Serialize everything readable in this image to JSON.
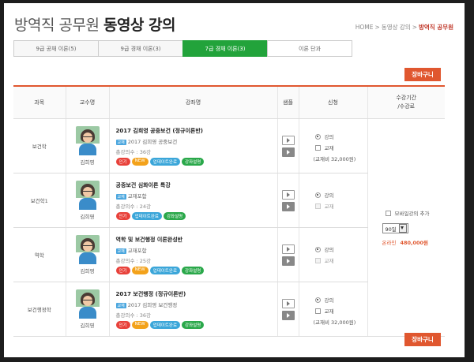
{
  "header": {
    "title_light": "방역직 공무원",
    "title_bold": "동영상 강의",
    "breadcrumb": [
      "HOME",
      "동영상 강의",
      "방역직 공무원"
    ]
  },
  "tabs": [
    {
      "label": "9급 공채 이론(5)",
      "active": false
    },
    {
      "label": "9급 경채 이론(3)",
      "active": false
    },
    {
      "label": "7급 경채 이론(3)",
      "active": true
    },
    {
      "label": "이론 단과",
      "active": false
    }
  ],
  "cart_label": "장바구니",
  "table": {
    "headers": {
      "subject": "과목",
      "professor": "교수명",
      "lecture": "강좌명",
      "sample": "샘플",
      "apply": "신청",
      "period_line1": "수강기간",
      "period_line2": "/수강료"
    },
    "rows": [
      {
        "subject": "보건학",
        "professor": "김희영",
        "title": "2017 김희영 공중보건 (정규이론반)",
        "tag": "교재",
        "subtitle": "2017 김희영 공중보건",
        "count": "총강의수 : 36강",
        "badges": [
          "인기",
          "NEW",
          "업데이트완료",
          "강좌설명"
        ],
        "apply_lecture": "강의",
        "apply_book": "교재",
        "fee": "(교재비 32,000원)"
      },
      {
        "subject": "보건학1",
        "professor": "김희영",
        "title": "공중보건 심화이론 특강",
        "tag": "교재",
        "subtitle": "교재포함",
        "count": "총강의수 : 24강",
        "badges": [
          "인기",
          "업데이트완료",
          "강좌설명"
        ],
        "apply_lecture": "강의",
        "apply_book": "교재",
        "fee": ""
      },
      {
        "subject": "역학",
        "professor": "김희영",
        "title": "역학 및 보건행정 이론완성반",
        "tag": "교재",
        "subtitle": "교재포함",
        "count": "총강의수 : 25강",
        "badges": [
          "인기",
          "NEW",
          "업데이트완료",
          "강좌설명"
        ],
        "apply_lecture": "강의",
        "apply_book": "교재",
        "fee": ""
      },
      {
        "subject": "보건행정학",
        "professor": "김희영",
        "title": "2017 보건행정 (정규이론반)",
        "tag": "교재",
        "subtitle": "2017 김희영 보건행정",
        "count": "총강의수 : 36강",
        "badges": [
          "인기",
          "NEW",
          "업데이트완료",
          "강좌설명"
        ],
        "apply_lecture": "강의",
        "apply_book": "교재",
        "fee": "(교재비 32,000원)"
      }
    ],
    "period": {
      "mobile_label": "모바일강의 추가",
      "period_value": "90일",
      "price_label": "온라인",
      "price_value": "480,000원"
    }
  },
  "colors": {
    "accent": "#e0572f",
    "active_tab": "#22a33b",
    "badge_popular": "#e8413a",
    "badge_new": "#f3a21b",
    "badge_update": "#3ba6d9",
    "badge_desc": "#2aa84a"
  }
}
